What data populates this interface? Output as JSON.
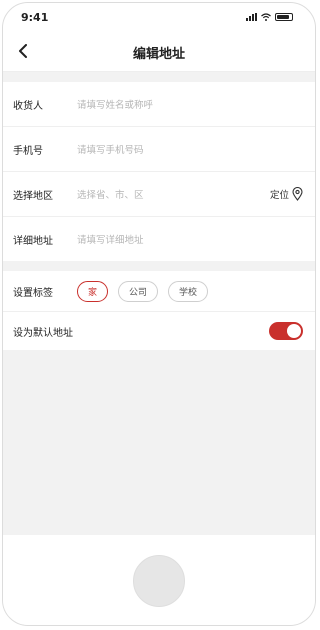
{
  "status_bar": {
    "time": "9:41"
  },
  "nav": {
    "title": "编辑地址"
  },
  "form": {
    "receiver": {
      "label": "收货人",
      "placeholder": "请填写姓名或称呼"
    },
    "phone": {
      "label": "手机号",
      "placeholder": "请填写手机号码"
    },
    "region": {
      "label": "选择地区",
      "placeholder": "选择省、市、区",
      "locate_label": "定位"
    },
    "detail": {
      "label": "详细地址",
      "placeholder": "请填写详细地址"
    }
  },
  "tags": {
    "label": "设置标签",
    "options": [
      "家",
      "公司",
      "学校"
    ],
    "selected": "家"
  },
  "default_address": {
    "label": "设为默认地址",
    "enabled": true
  },
  "colors": {
    "accent": "#c9302c"
  }
}
